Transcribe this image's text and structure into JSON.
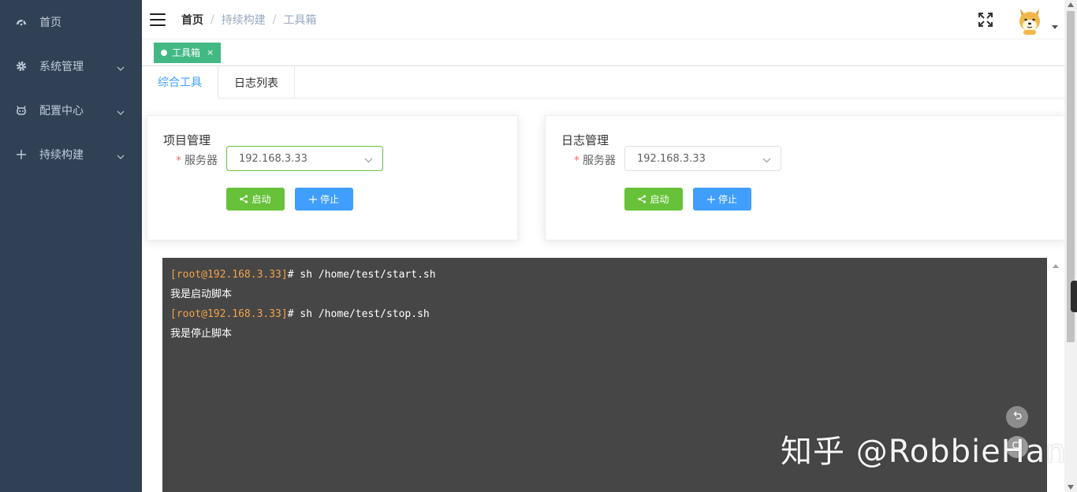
{
  "sidebar": {
    "items": [
      {
        "label": "首页",
        "icon": "dashboard-icon"
      },
      {
        "label": "系统管理",
        "icon": "gear-icon",
        "has_submenu": true
      },
      {
        "label": "配置中心",
        "icon": "bug-icon",
        "has_submenu": true
      },
      {
        "label": "持续构建",
        "icon": "plus-icon",
        "has_submenu": true
      }
    ]
  },
  "navbar": {
    "breadcrumb": [
      "首页",
      "持续构建",
      "工具箱"
    ]
  },
  "tags": [
    {
      "label": "工具箱",
      "active": true,
      "close": "×"
    }
  ],
  "tabs": [
    {
      "label": "综合工具",
      "active": true
    },
    {
      "label": "日志列表",
      "active": false
    }
  ],
  "cards": {
    "project": {
      "title": "项目管理",
      "required_mark": "*",
      "label": "服务器",
      "selected": "192.168.3.33",
      "start_label": "启动",
      "stop_label": "停止"
    },
    "log": {
      "title": "日志管理",
      "required_mark": "*",
      "label": "服务器",
      "selected": "192.168.3.33",
      "start_label": "启动",
      "stop_label": "停止"
    }
  },
  "terminal": {
    "lines": [
      {
        "prompt": "[root@192.168.3.33]",
        "cmd": "# sh /home/test/start.sh"
      },
      {
        "output": "我是启动脚本"
      },
      {
        "prompt": "[root@192.168.3.33]",
        "cmd": "# sh /home/test/stop.sh"
      },
      {
        "output": "我是停止脚本"
      }
    ]
  },
  "watermark": "知乎 @RobbieHan",
  "colors": {
    "sidebar_bg": "#304156",
    "tag_green": "#42b983",
    "start_green": "#67c23a",
    "stop_blue": "#409eff",
    "terminal_bg": "#464646",
    "prompt_orange": "#f0a44a"
  }
}
